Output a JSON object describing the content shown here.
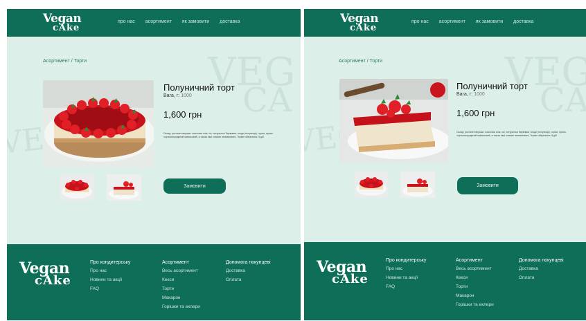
{
  "brand": {
    "line1": "Vegan",
    "line2": "cAke"
  },
  "nav": [
    "про нас",
    "асортимент",
    "як замовити",
    "доставка"
  ],
  "background_words": {
    "line1": "VEG",
    "line2": "CA"
  },
  "breadcrumb": "Асортимент / Торти",
  "screens": [
    {
      "product": {
        "title": "Полуничний торт",
        "weight_label": "Вага, г:",
        "weight_value": "1000",
        "price": "1,600 грн",
        "description": "Склад: рослинні вершки, кокосова олія, сік, натуральні барвники, ягоди (полуниця), горіхи, пряно-чорносмородиний маніоковий, а також інші злакові наповнювачі. Термін зберігання: 5 діб",
        "order_label": "Замовити"
      }
    },
    {
      "product": {
        "title": "Полуничний торт",
        "weight_label": "Вага, г:",
        "weight_value": "1000",
        "price": "1,600 грн",
        "description": "Склад: рослинні вершки, кокосова олія, сік, натуральні барвники, ягоди (полуниця), горіхи, пряно-чорносмородиний маніоковий, а також інші злакові наповнювачі. Термін зберігання: 5 діб",
        "order_label": "Замовити"
      }
    }
  ],
  "footer": {
    "columns": [
      {
        "heading": "Про кондитерську",
        "links": [
          "Про нас",
          "Новини та акції",
          "FAQ"
        ]
      },
      {
        "heading": "Асортимент",
        "links": [
          "Весь асортимент",
          "Кекси",
          "Торти",
          "Макарон",
          "Горішки та еклери"
        ]
      },
      {
        "heading": "Допомога покупцеві",
        "links": [
          "Доставка",
          "Оплата"
        ]
      }
    ]
  },
  "colors": {
    "header": "#0e6e57",
    "background": "#dcefe9",
    "accent": "#0e6e57"
  }
}
